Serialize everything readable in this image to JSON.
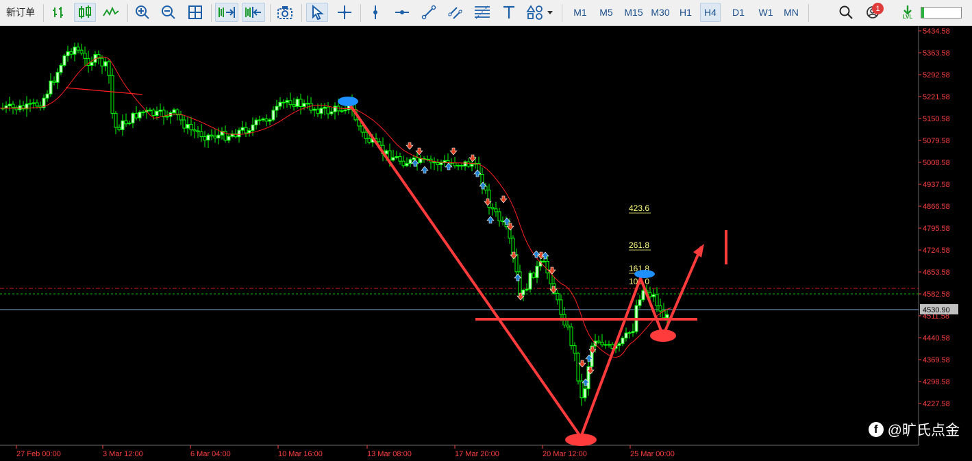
{
  "toolbar": {
    "new_order": "新订单",
    "timeframes": [
      "M1",
      "M5",
      "M15",
      "M30",
      "H1",
      "H4",
      "D1",
      "W1",
      "MN"
    ],
    "active_timeframe": "H4",
    "notification_count": "1",
    "level_label": "LVL"
  },
  "icons": [
    "candle-chart-icon",
    "bar-chart-icon",
    "line-chart-icon",
    "zoom-in-icon",
    "zoom-out-icon",
    "grid-icon",
    "autoscroll-icon",
    "chart-shift-icon",
    "screenshot-icon",
    "cursor-icon",
    "crosshair-icon",
    "vertical-line-icon",
    "horizontal-line-icon",
    "trendline-icon",
    "channel-icon",
    "fibonacci-icon",
    "text-icon",
    "shapes-icon",
    "search-icon",
    "user-icon",
    "signal-icon"
  ],
  "colors": {
    "bull_candle": "#ccffcc",
    "bear_candle": "#000000",
    "wick": "#00ff00",
    "moving_average": "#ff2020",
    "annotation": "#ff3b3b",
    "marker_blue": "#1e90ff",
    "fibo_text": "#ffff80",
    "axis_text": "#ff4040",
    "bid_line": "#7aa7d6",
    "current_price_box": "#c0c0c0"
  },
  "chart": {
    "price_labels": [
      "5434.58",
      "5363.58",
      "5292.58",
      "5221.58",
      "5150.58",
      "5079.58",
      "5008.58",
      "4937.58",
      "4866.58",
      "4795.58",
      "4724.58",
      "4653.58",
      "4582.58",
      "4511.58",
      "4440.58",
      "4369.58",
      "4298.58",
      "4227.58"
    ],
    "current_price": "4530.90",
    "time_labels": [
      "27 Feb 00:00",
      "3 Mar 12:00",
      "6 Mar 04:00",
      "10 Mar 16:00",
      "13 Mar 08:00",
      "17 Mar 20:00",
      "20 Mar 12:00",
      "25 Mar 00:00"
    ],
    "fibo_levels": [
      "423.6",
      "261.8",
      "161.8",
      "100.0"
    ]
  },
  "watermark": {
    "text": "@旷氏点金",
    "icon": "facebook-icon"
  }
}
